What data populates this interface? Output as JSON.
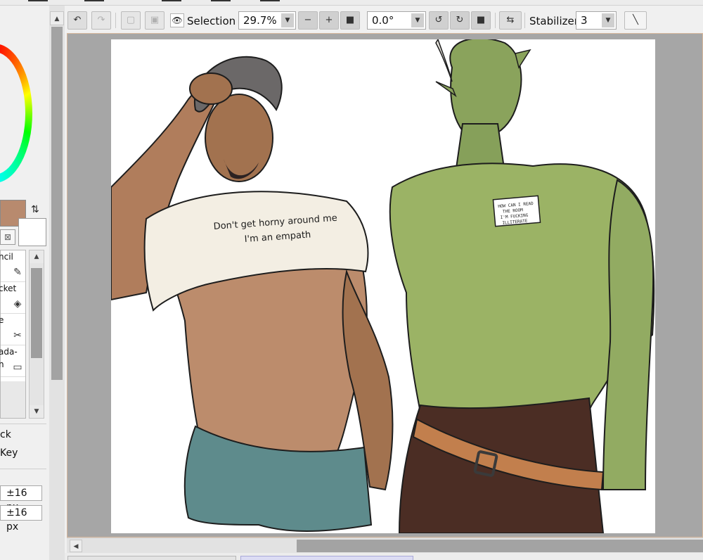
{
  "toolbar": {
    "selection_label": "Selection",
    "zoom_value": "29.7%",
    "zoom_out_symbol": "−",
    "zoom_in_symbol": "+",
    "zoom_reset_symbol": "■",
    "rotation_value": "0.0°",
    "rotate_ccw_symbol": "↺",
    "rotate_cw_symbol": "↻",
    "rotate_reset_symbol": "■",
    "flip_symbol": "⇆",
    "stabilizer_label": "Stabilizer",
    "stabilizer_value": "3",
    "undo_symbol": "↶",
    "redo_symbol": "↷",
    "eye_symbol": "👁",
    "stroke_symbol": "╲"
  },
  "colors": {
    "current_color": "#b88a6e",
    "canvas_border": "#d7b79b"
  },
  "tools": [
    {
      "line1": "ncil",
      "line2": "",
      "icon": "pencil-icon",
      "glyph": "✎"
    },
    {
      "line1": "cket",
      "line2": "",
      "icon": "bucket-icon",
      "glyph": "◈"
    },
    {
      "line1": "e",
      "line2": "",
      "icon": "scissors-icon",
      "glyph": "✂"
    },
    {
      "line1": "ada-",
      "line2": "n",
      "icon": "gradient-icon",
      "glyph": "▭"
    }
  ],
  "options": {
    "lock_label": "ck",
    "key_label": "Key",
    "px_field_1": "±16 px",
    "px_field_2": "±16 px"
  },
  "artwork": {
    "shirt_text_line1": "Don't get horny around me",
    "shirt_text_line2": "I'm an empath",
    "tag_line1": "HOW CAN I READ",
    "tag_line2": "THE ROOM",
    "tag_line3": "I'M FUCKING",
    "tag_line4": "ILLITERATE"
  }
}
